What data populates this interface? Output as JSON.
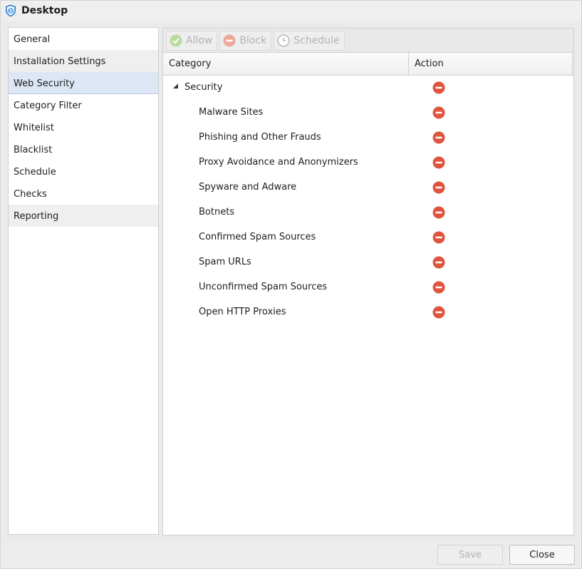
{
  "window": {
    "title": "Desktop",
    "icon": "shield-icon"
  },
  "sidebar": {
    "items": [
      {
        "label": "General",
        "state": "normal"
      },
      {
        "label": "Installation Settings",
        "state": "grey"
      },
      {
        "label": "Web Security",
        "state": "selected"
      },
      {
        "label": "Category Filter",
        "state": "normal"
      },
      {
        "label": "Whitelist",
        "state": "normal"
      },
      {
        "label": "Blacklist",
        "state": "normal"
      },
      {
        "label": "Schedule",
        "state": "normal"
      },
      {
        "label": "Checks",
        "state": "normal"
      },
      {
        "label": "Reporting",
        "state": "grey"
      }
    ]
  },
  "toolbar": {
    "allow_label": "Allow",
    "block_label": "Block",
    "schedule_label": "Schedule"
  },
  "table": {
    "columns": {
      "category": "Category",
      "action": "Action"
    },
    "rows": [
      {
        "label": "Security",
        "level": 0,
        "expanded": true,
        "action": "block"
      },
      {
        "label": "Malware Sites",
        "level": 1,
        "action": "block"
      },
      {
        "label": "Phishing and Other Frauds",
        "level": 1,
        "action": "block"
      },
      {
        "label": "Proxy Avoidance and Anonymizers",
        "level": 1,
        "action": "block"
      },
      {
        "label": "Spyware and Adware",
        "level": 1,
        "action": "block"
      },
      {
        "label": "Botnets",
        "level": 1,
        "action": "block"
      },
      {
        "label": "Confirmed Spam Sources",
        "level": 1,
        "action": "block"
      },
      {
        "label": "Spam URLs",
        "level": 1,
        "action": "block"
      },
      {
        "label": "Unconfirmed Spam Sources",
        "level": 1,
        "action": "block"
      },
      {
        "label": "Open HTTP Proxies",
        "level": 1,
        "action": "block"
      }
    ]
  },
  "footer": {
    "save_label": "Save",
    "close_label": "Close"
  },
  "colors": {
    "block_red": "#e0533c",
    "allow_green": "#8fc46a",
    "selected_bg": "#dce6f4",
    "disabled_text": "#b3b3b3"
  }
}
